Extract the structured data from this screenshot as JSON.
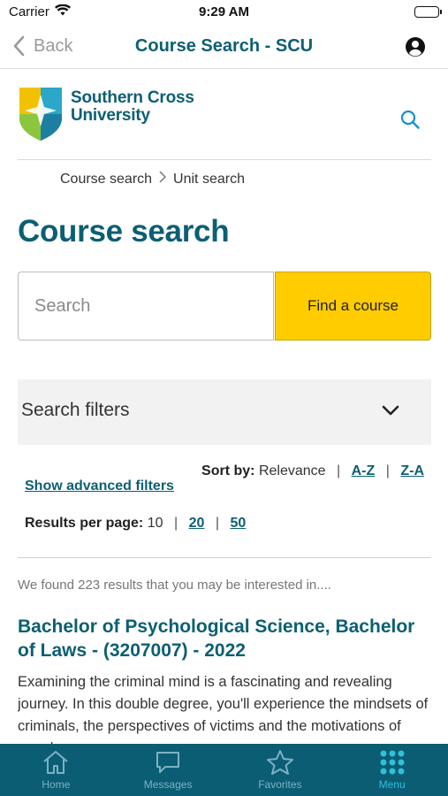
{
  "status_bar": {
    "carrier": "Carrier",
    "time": "9:29 AM"
  },
  "nav": {
    "back_label": "Back",
    "title": "Course Search - SCU"
  },
  "header": {
    "logo_line1": "Southern Cross",
    "logo_line2": "University"
  },
  "breadcrumb": {
    "item1": "Course search",
    "item2": "Unit search"
  },
  "page_title": "Course search",
  "search": {
    "placeholder": "Search",
    "value": "",
    "button_label": "Find a course"
  },
  "filters": {
    "label": "Search filters"
  },
  "sort": {
    "label": "Sort by:",
    "current": "Relevance",
    "option_az": "A-Z",
    "option_za": "Z-A"
  },
  "advanced_filters_label": "Show advanced filters",
  "per_page": {
    "label": "Results per page:",
    "current": "10",
    "option_20": "20",
    "option_50": "50"
  },
  "results": {
    "count_text": "We found 223 results that you may be interested in....",
    "items": [
      {
        "title": "Bachelor of Psychological Science, Bachelor of Laws - (3207007) - 2022",
        "description": "Examining the criminal mind is a fascinating and revealing journey. In this double degree, you'll experience the mindsets of criminals, the perspectives of victims and the motivations of people..."
      }
    ]
  },
  "tabs": [
    {
      "label": "Home",
      "icon": "home-icon"
    },
    {
      "label": "Messages",
      "icon": "message-icon"
    },
    {
      "label": "Favorites",
      "icon": "star-icon"
    },
    {
      "label": "Menu",
      "icon": "grid-icon",
      "active": true
    }
  ],
  "colors": {
    "brand": "#0c5f73",
    "accent": "#ffcc00",
    "tab_bar": "#0b5d74",
    "tab_active": "#30c0d8"
  }
}
